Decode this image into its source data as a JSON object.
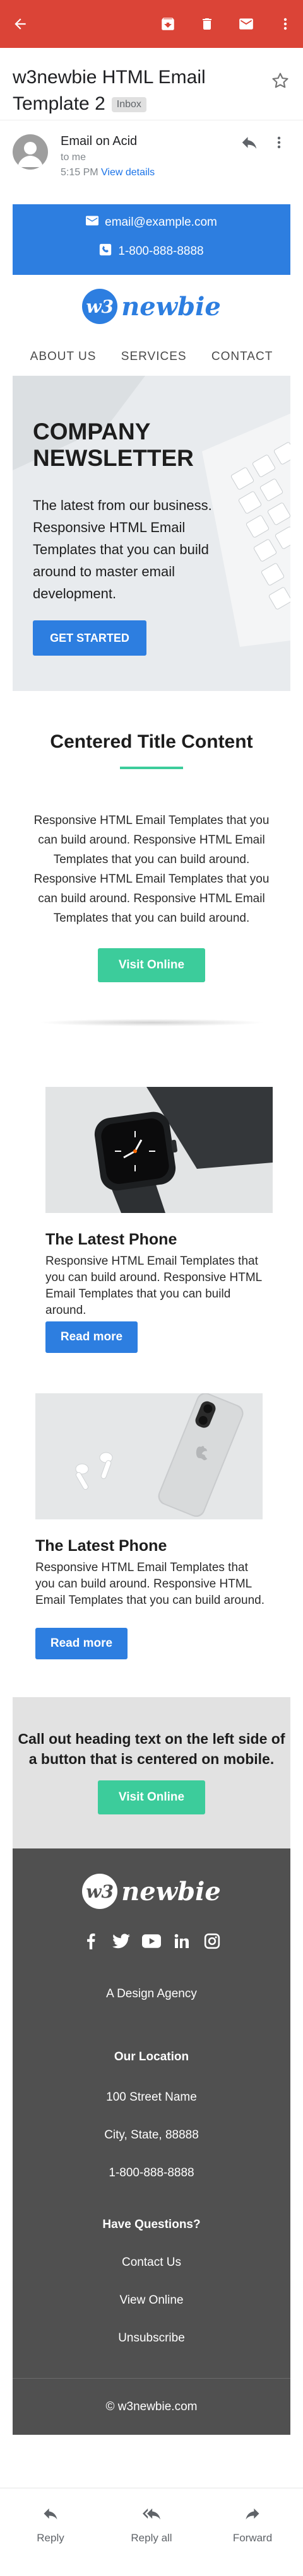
{
  "appbar": {
    "color": "#db4437",
    "icons": [
      "back-arrow-icon",
      "archive-icon",
      "delete-icon",
      "mail-icon",
      "more-vert-icon"
    ]
  },
  "subject": {
    "title": "w3newbie HTML Email Template 2",
    "badge": "Inbox"
  },
  "sender": {
    "name": "Email on Acid",
    "to": "to me",
    "time": "5:15 PM",
    "view_details": "View details"
  },
  "email": {
    "topbar": {
      "email": "email@example.com",
      "phone": "1-800-888-8888",
      "color": "#2d7ee0"
    },
    "logo": {
      "badge": "w3",
      "text": "newbie"
    },
    "nav": [
      "ABOUT US",
      "SERVICES",
      "CONTACT"
    ],
    "hero": {
      "title": "COMPANY NEWSLETTER",
      "text": "The latest from our business. Responsive HTML Email Templates that you can build around to master email development.",
      "button": "GET STARTED"
    },
    "centered": {
      "title": "Centered Title Content",
      "text": "Responsive HTML Email Templates that you can build around. Responsive HTML Email Templates that you can build around. Responsive HTML Email Templates that you can build around. Responsive HTML Email Templates that you can build around.",
      "button": "Visit Online",
      "accent": "#3ccc9b"
    },
    "card1": {
      "title": "The Latest Phone",
      "text": "Responsive HTML Email Templates that you can build around. Responsive HTML Email Templates that you can build around.",
      "button": "Read more"
    },
    "card2": {
      "title": "The Latest Phone",
      "text": "Responsive HTML Email Templates that you can build around. Responsive HTML Email Templates that you can build around.",
      "button": "Read more"
    },
    "callout": {
      "title": "Call out heading text on the left side of a button that is centered on mobile.",
      "button": "Visit Online"
    },
    "footer": {
      "logo_badge": "w3",
      "logo_text": "newbie",
      "social_icons": [
        "facebook-icon",
        "twitter-icon",
        "youtube-icon",
        "linkedin-icon",
        "instagram-icon"
      ],
      "tagline": "A Design Agency",
      "location_heading": "Our Location",
      "address1": "100 Street Name",
      "address2": "City, State, 88888",
      "phone": "1-800-888-8888",
      "questions_heading": "Have Questions?",
      "contact": "Contact Us",
      "view_online": "View Online",
      "unsubscribe": "Unsubscribe",
      "copyright": "© w3newbie.com"
    }
  },
  "bottombar": {
    "reply": "Reply",
    "reply_all": "Reply all",
    "forward": "Forward"
  }
}
